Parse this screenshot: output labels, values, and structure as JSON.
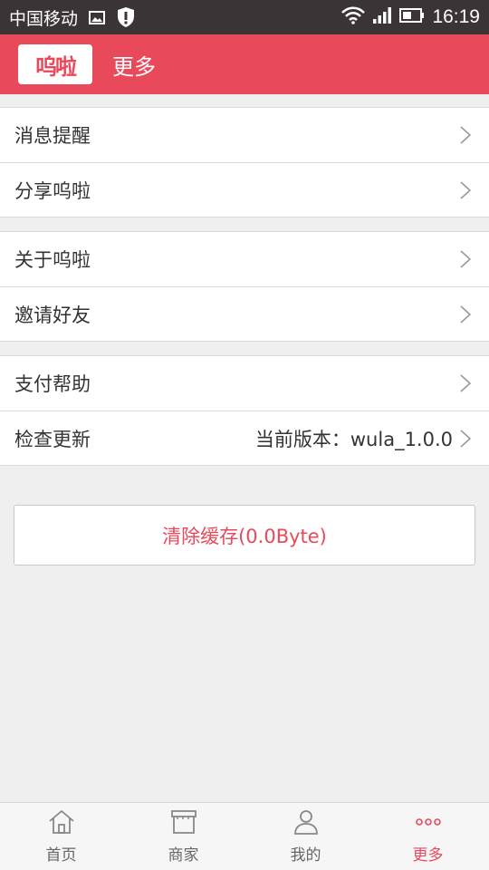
{
  "status_bar": {
    "carrier": "中国移动",
    "time": "16:19"
  },
  "header": {
    "logo_text": "呜啦",
    "title": "更多"
  },
  "groups": [
    {
      "items": [
        {
          "label": "消息提醒"
        },
        {
          "label": "分享呜啦"
        }
      ]
    },
    {
      "items": [
        {
          "label": "关于呜啦"
        },
        {
          "label": "邀请好友"
        }
      ]
    },
    {
      "items": [
        {
          "label": "支付帮助"
        },
        {
          "label": "检查更新",
          "value": "当前版本：wula_1.0.0"
        }
      ]
    }
  ],
  "clear_cache_label": "清除缓存(0.0Byte)",
  "bottom_nav": {
    "items": [
      {
        "label": "首页",
        "icon": "home-icon"
      },
      {
        "label": "商家",
        "icon": "store-icon"
      },
      {
        "label": "我的",
        "icon": "person-icon"
      },
      {
        "label": "更多",
        "icon": "more-dots-icon"
      }
    ],
    "active_index": 3
  },
  "colors": {
    "accent": "#e94a5b",
    "status_bar": "#3b3437",
    "background": "#efefef"
  }
}
